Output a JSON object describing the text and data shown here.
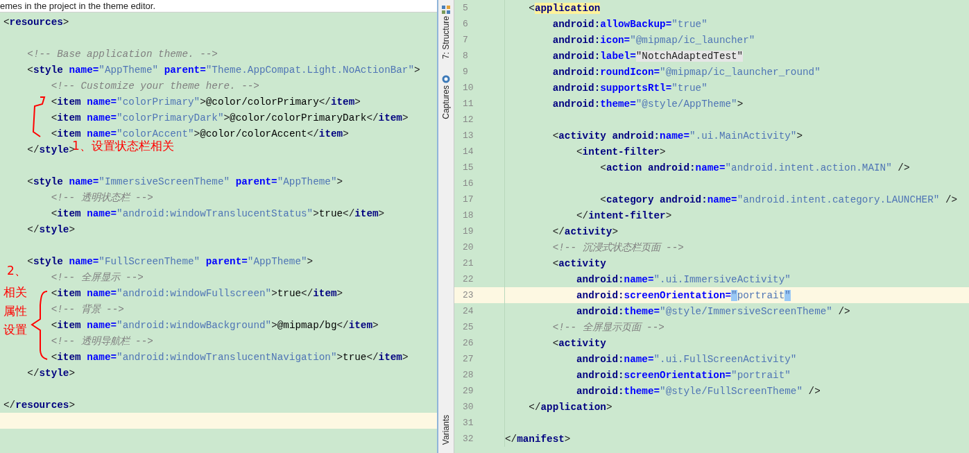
{
  "left_editor": {
    "hint": "emes in the project in the theme editor.",
    "lines": [
      {
        "current": false,
        "tokens": [
          {
            "kind": "p",
            "text": "<"
          },
          {
            "kind": "tag",
            "text": "resources"
          },
          {
            "kind": "p",
            "text": ">"
          }
        ]
      },
      {
        "current": false
      },
      {
        "current": false,
        "tokens": [
          {
            "kind": "cm",
            "text": "    <!-- Base application theme. -->"
          }
        ]
      },
      {
        "current": false,
        "tokens": [
          {
            "kind": "p",
            "text": "    <"
          },
          {
            "kind": "tag",
            "text": "style"
          },
          {
            "kind": "attr",
            "text": " name="
          },
          {
            "kind": "val",
            "text": "\"AppTheme\""
          },
          {
            "kind": "attr",
            "text": " parent="
          },
          {
            "kind": "val",
            "text": "\"Theme.AppCompat.Light.NoActionBar\""
          },
          {
            "kind": "p",
            "text": ">"
          }
        ]
      },
      {
        "current": false,
        "tokens": [
          {
            "kind": "cm",
            "text": "        <!-- Customize your theme here. -->"
          }
        ]
      },
      {
        "current": false,
        "tokens": [
          {
            "kind": "p",
            "text": "        <"
          },
          {
            "kind": "tag",
            "text": "item"
          },
          {
            "kind": "attr",
            "text": " name="
          },
          {
            "kind": "val",
            "text": "\"colorPrimary\""
          },
          {
            "kind": "p",
            "text": ">"
          },
          {
            "kind": "txt",
            "text": "@color/colorPrimary"
          },
          {
            "kind": "p",
            "text": "</"
          },
          {
            "kind": "tag",
            "text": "item"
          },
          {
            "kind": "p",
            "text": ">"
          }
        ]
      },
      {
        "current": false,
        "tokens": [
          {
            "kind": "p",
            "text": "        <"
          },
          {
            "kind": "tag",
            "text": "item"
          },
          {
            "kind": "attr",
            "text": " name="
          },
          {
            "kind": "val",
            "text": "\"colorPrimaryDark\""
          },
          {
            "kind": "p",
            "text": ">"
          },
          {
            "kind": "txt",
            "text": "@color/colorPrimaryDark"
          },
          {
            "kind": "p",
            "text": "</"
          },
          {
            "kind": "tag",
            "text": "item"
          },
          {
            "kind": "p",
            "text": ">"
          }
        ]
      },
      {
        "current": false,
        "tokens": [
          {
            "kind": "p",
            "text": "        <"
          },
          {
            "kind": "tag",
            "text": "item"
          },
          {
            "kind": "attr",
            "text": " name="
          },
          {
            "kind": "val",
            "text": "\"colorAccent\""
          },
          {
            "kind": "p",
            "text": ">"
          },
          {
            "kind": "txt",
            "text": "@color/colorAccent"
          },
          {
            "kind": "p",
            "text": "</"
          },
          {
            "kind": "tag",
            "text": "item"
          },
          {
            "kind": "p",
            "text": ">"
          }
        ]
      },
      {
        "current": false,
        "tokens": [
          {
            "kind": "p",
            "text": "    </"
          },
          {
            "kind": "tag",
            "text": "style"
          },
          {
            "kind": "p",
            "text": ">"
          }
        ]
      },
      {
        "current": false
      },
      {
        "current": false,
        "tokens": [
          {
            "kind": "p",
            "text": "    <"
          },
          {
            "kind": "tag",
            "text": "style"
          },
          {
            "kind": "attr",
            "text": " name="
          },
          {
            "kind": "val",
            "text": "\"ImmersiveScreenTheme\""
          },
          {
            "kind": "attr",
            "text": " parent="
          },
          {
            "kind": "val",
            "text": "\"AppTheme\""
          },
          {
            "kind": "p",
            "text": ">"
          }
        ]
      },
      {
        "current": false,
        "tokens": [
          {
            "kind": "cm",
            "text": "        <!-- 透明状态栏 -->"
          }
        ]
      },
      {
        "current": false,
        "tokens": [
          {
            "kind": "p",
            "text": "        <"
          },
          {
            "kind": "tag",
            "text": "item"
          },
          {
            "kind": "attr",
            "text": " name="
          },
          {
            "kind": "val",
            "text": "\"android:windowTranslucentStatus\""
          },
          {
            "kind": "p",
            "text": ">"
          },
          {
            "kind": "txt",
            "text": "true"
          },
          {
            "kind": "p",
            "text": "</"
          },
          {
            "kind": "tag",
            "text": "item"
          },
          {
            "kind": "p",
            "text": ">"
          }
        ]
      },
      {
        "current": false,
        "tokens": [
          {
            "kind": "p",
            "text": "    </"
          },
          {
            "kind": "tag",
            "text": "style"
          },
          {
            "kind": "p",
            "text": ">"
          }
        ]
      },
      {
        "current": false
      },
      {
        "current": false,
        "tokens": [
          {
            "kind": "p",
            "text": "    <"
          },
          {
            "kind": "tag",
            "text": "style"
          },
          {
            "kind": "attr",
            "text": " name="
          },
          {
            "kind": "val",
            "text": "\"FullScreenTheme\""
          },
          {
            "kind": "attr",
            "text": " parent="
          },
          {
            "kind": "val",
            "text": "\"AppTheme\""
          },
          {
            "kind": "p",
            "text": ">"
          }
        ]
      },
      {
        "current": false,
        "tokens": [
          {
            "kind": "cm",
            "text": "        <!-- 全屏显示 -->"
          }
        ]
      },
      {
        "current": false,
        "tokens": [
          {
            "kind": "p",
            "text": "        <"
          },
          {
            "kind": "tag",
            "text": "item"
          },
          {
            "kind": "attr",
            "text": " name="
          },
          {
            "kind": "val",
            "text": "\"android:windowFullscreen\""
          },
          {
            "kind": "p",
            "text": ">"
          },
          {
            "kind": "txt",
            "text": "true"
          },
          {
            "kind": "p",
            "text": "</"
          },
          {
            "kind": "tag",
            "text": "item"
          },
          {
            "kind": "p",
            "text": ">"
          }
        ]
      },
      {
        "current": false,
        "tokens": [
          {
            "kind": "cm",
            "text": "        <!-- 背景 -->"
          }
        ]
      },
      {
        "current": false,
        "tokens": [
          {
            "kind": "p",
            "text": "        <"
          },
          {
            "kind": "tag",
            "text": "item"
          },
          {
            "kind": "attr",
            "text": " name="
          },
          {
            "kind": "val",
            "text": "\"android:windowBackground\""
          },
          {
            "kind": "p",
            "text": ">"
          },
          {
            "kind": "txt",
            "text": "@mipmap/bg"
          },
          {
            "kind": "p",
            "text": "</"
          },
          {
            "kind": "tag",
            "text": "item"
          },
          {
            "kind": "p",
            "text": ">"
          }
        ]
      },
      {
        "current": false,
        "tokens": [
          {
            "kind": "cm",
            "text": "        <!-- 透明导航栏 -->"
          }
        ]
      },
      {
        "current": false,
        "tokens": [
          {
            "kind": "p",
            "text": "        <"
          },
          {
            "kind": "tag",
            "text": "item"
          },
          {
            "kind": "attr",
            "text": " name="
          },
          {
            "kind": "val",
            "text": "\"android:windowTranslucentNavigation\""
          },
          {
            "kind": "p",
            "text": ">"
          },
          {
            "kind": "txt",
            "text": "true"
          },
          {
            "kind": "p",
            "text": "</"
          },
          {
            "kind": "tag",
            "text": "item"
          },
          {
            "kind": "p",
            "text": ">"
          }
        ]
      },
      {
        "current": false,
        "tokens": [
          {
            "kind": "p",
            "text": "    </"
          },
          {
            "kind": "tag",
            "text": "style"
          },
          {
            "kind": "p",
            "text": ">"
          }
        ]
      },
      {
        "current": false
      },
      {
        "current": false,
        "tokens": [
          {
            "kind": "p",
            "text": "</"
          },
          {
            "kind": "tag",
            "text": "resources"
          },
          {
            "kind": "p",
            "text": ">"
          }
        ]
      },
      {
        "current": true
      }
    ]
  },
  "annotations": [
    {
      "text": "1、设置状态栏相关"
    },
    {
      "text": "2、"
    },
    {
      "text": "相关"
    },
    {
      "text": "属性"
    },
    {
      "text": "设置"
    }
  ],
  "tool_windows": [
    {
      "label": "7: Structure",
      "kind": "structure"
    },
    {
      "label": "Captures",
      "kind": "captures"
    },
    {
      "label": "Variants",
      "kind": "plain"
    }
  ],
  "right_editor": {
    "lines": [
      {
        "number": "5",
        "current": false,
        "tokens": [
          {
            "kind": "p",
            "text": "    <"
          },
          {
            "kind": "tagmatch",
            "text": "application"
          }
        ]
      },
      {
        "number": "6",
        "current": false,
        "tokens": [
          {
            "kind": "ns",
            "text": "        android:"
          },
          {
            "kind": "attr",
            "text": "allowBackup="
          },
          {
            "kind": "val",
            "text": "\"true\""
          }
        ]
      },
      {
        "number": "7",
        "current": false,
        "tokens": [
          {
            "kind": "ns",
            "text": "        android:"
          },
          {
            "kind": "attr",
            "text": "icon="
          },
          {
            "kind": "val",
            "text": "\"@mipmap/ic_launcher\""
          }
        ]
      },
      {
        "number": "8",
        "current": false,
        "tokens": [
          {
            "kind": "ns",
            "text": "        android:"
          },
          {
            "kind": "attr",
            "text": "label="
          },
          {
            "kind": "folded",
            "text": "\"NotchAdaptedTest\""
          }
        ]
      },
      {
        "number": "9",
        "current": false,
        "tokens": [
          {
            "kind": "ns",
            "text": "        android:"
          },
          {
            "kind": "attr",
            "text": "roundIcon="
          },
          {
            "kind": "val",
            "text": "\"@mipmap/ic_launcher_round\""
          }
        ]
      },
      {
        "number": "10",
        "current": false,
        "tokens": [
          {
            "kind": "ns",
            "text": "        android:"
          },
          {
            "kind": "attr",
            "text": "supportsRtl="
          },
          {
            "kind": "val",
            "text": "\"true\""
          }
        ]
      },
      {
        "number": "11",
        "current": false,
        "tokens": [
          {
            "kind": "ns",
            "text": "        android:"
          },
          {
            "kind": "attr",
            "text": "theme="
          },
          {
            "kind": "val",
            "text": "\"@style/AppTheme\""
          },
          {
            "kind": "p",
            "text": ">"
          }
        ]
      },
      {
        "number": "12",
        "current": false
      },
      {
        "number": "13",
        "current": false,
        "tokens": [
          {
            "kind": "p",
            "text": "        <"
          },
          {
            "kind": "tag",
            "text": "activity"
          },
          {
            "kind": "ns",
            "text": " android:"
          },
          {
            "kind": "attr",
            "text": "name="
          },
          {
            "kind": "val",
            "text": "\".ui.MainActivity\""
          },
          {
            "kind": "p",
            "text": ">"
          }
        ]
      },
      {
        "number": "14",
        "current": false,
        "tokens": [
          {
            "kind": "p",
            "text": "            <"
          },
          {
            "kind": "tag",
            "text": "intent-filter"
          },
          {
            "kind": "p",
            "text": ">"
          }
        ]
      },
      {
        "number": "15",
        "current": false,
        "tokens": [
          {
            "kind": "p",
            "text": "                <"
          },
          {
            "kind": "tag",
            "text": "action"
          },
          {
            "kind": "ns",
            "text": " android:"
          },
          {
            "kind": "attr",
            "text": "name="
          },
          {
            "kind": "val",
            "text": "\"android.intent.action.MAIN\""
          },
          {
            "kind": "p",
            "text": " />"
          }
        ]
      },
      {
        "number": "16",
        "current": false
      },
      {
        "number": "17",
        "current": false,
        "tokens": [
          {
            "kind": "p",
            "text": "                <"
          },
          {
            "kind": "tag",
            "text": "category"
          },
          {
            "kind": "ns",
            "text": " android:"
          },
          {
            "kind": "attr",
            "text": "name="
          },
          {
            "kind": "val",
            "text": "\"android.intent.category.LAUNCHER\""
          },
          {
            "kind": "p",
            "text": " />"
          }
        ]
      },
      {
        "number": "18",
        "current": false,
        "tokens": [
          {
            "kind": "p",
            "text": "            </"
          },
          {
            "kind": "tag",
            "text": "intent-filter"
          },
          {
            "kind": "p",
            "text": ">"
          }
        ]
      },
      {
        "number": "19",
        "current": false,
        "tokens": [
          {
            "kind": "p",
            "text": "        </"
          },
          {
            "kind": "tag",
            "text": "activity"
          },
          {
            "kind": "p",
            "text": ">"
          }
        ]
      },
      {
        "number": "20",
        "current": false,
        "tokens": [
          {
            "kind": "cm",
            "text": "        <!-- 沉浸式状态栏页面 -->"
          }
        ]
      },
      {
        "number": "21",
        "current": false,
        "tokens": [
          {
            "kind": "p",
            "text": "        <"
          },
          {
            "kind": "tag",
            "text": "activity"
          }
        ]
      },
      {
        "number": "22",
        "current": false,
        "tokens": [
          {
            "kind": "ns",
            "text": "            android:"
          },
          {
            "kind": "attr",
            "text": "name="
          },
          {
            "kind": "val",
            "text": "\".ui.ImmersiveActivity\""
          }
        ]
      },
      {
        "number": "23",
        "current": true,
        "tokens": [
          {
            "kind": "ns",
            "text": "            android:"
          },
          {
            "kind": "attr",
            "text": "screenOrientation="
          },
          {
            "kind": "qmatch",
            "text": "\""
          },
          {
            "kind": "val",
            "text": "portrait"
          },
          {
            "kind": "qmatch",
            "text": "\""
          }
        ]
      },
      {
        "number": "24",
        "current": false,
        "tokens": [
          {
            "kind": "ns",
            "text": "            android:"
          },
          {
            "kind": "attr",
            "text": "theme="
          },
          {
            "kind": "val",
            "text": "\"@style/ImmersiveScreenTheme\""
          },
          {
            "kind": "p",
            "text": " />"
          }
        ]
      },
      {
        "number": "25",
        "current": false,
        "tokens": [
          {
            "kind": "cm",
            "text": "        <!-- 全屏显示页面 -->"
          }
        ]
      },
      {
        "number": "26",
        "current": false,
        "tokens": [
          {
            "kind": "p",
            "text": "        <"
          },
          {
            "kind": "tag",
            "text": "activity"
          }
        ]
      },
      {
        "number": "27",
        "current": false,
        "tokens": [
          {
            "kind": "ns",
            "text": "            android:"
          },
          {
            "kind": "attr",
            "text": "name="
          },
          {
            "kind": "val",
            "text": "\".ui.FullScreenActivity\""
          }
        ]
      },
      {
        "number": "28",
        "current": false,
        "tokens": [
          {
            "kind": "ns",
            "text": "            android:"
          },
          {
            "kind": "attr",
            "text": "screenOrientation="
          },
          {
            "kind": "val",
            "text": "\"portrait\""
          }
        ]
      },
      {
        "number": "29",
        "current": false,
        "tokens": [
          {
            "kind": "ns",
            "text": "            android:"
          },
          {
            "kind": "attr",
            "text": "theme="
          },
          {
            "kind": "val",
            "text": "\"@style/FullScreenTheme\""
          },
          {
            "kind": "p",
            "text": " />"
          }
        ]
      },
      {
        "number": "30",
        "current": false,
        "tokens": [
          {
            "kind": "p",
            "text": "    </"
          },
          {
            "kind": "tag",
            "text": "application"
          },
          {
            "kind": "p",
            "text": ">"
          }
        ]
      },
      {
        "number": "31",
        "current": false
      },
      {
        "number": "32",
        "current": false,
        "tokens": [
          {
            "kind": "p",
            "text": "</"
          },
          {
            "kind": "tag",
            "text": "manifest"
          },
          {
            "kind": "p",
            "text": ">"
          }
        ]
      }
    ]
  }
}
